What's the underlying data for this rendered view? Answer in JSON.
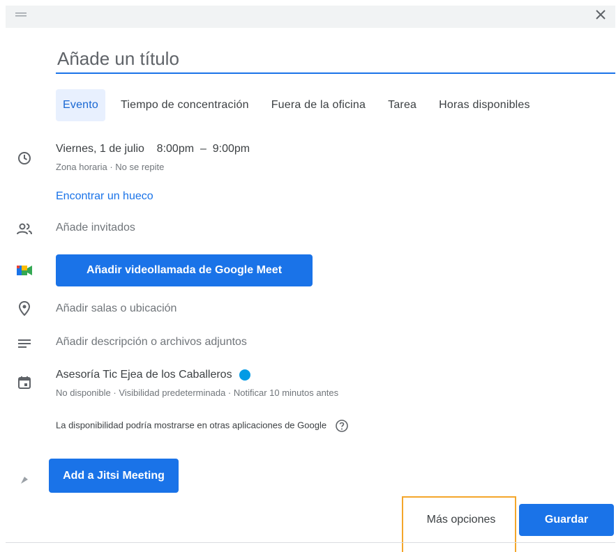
{
  "dialog": {
    "title_placeholder": "Añade un título"
  },
  "tabs": [
    {
      "label": "Evento",
      "active": true
    },
    {
      "label": "Tiempo de concentración",
      "active": false
    },
    {
      "label": "Fuera de la oficina",
      "active": false
    },
    {
      "label": "Tarea",
      "active": false
    },
    {
      "label": "Horas disponibles",
      "active": false
    }
  ],
  "datetime": {
    "main": "Viernes, 1 de julio    8:00pm  –  9:00pm",
    "sub": "Zona horaria · No se repite"
  },
  "find_slot_label": "Encontrar un hueco",
  "guests_label": "Añade invitados",
  "meet_button_label": "Añadir videollamada de Google Meet",
  "location_label": "Añadir salas o ubicación",
  "description_label": "Añadir descripción o archivos adjuntos",
  "calendar": {
    "name": "Asesoría Tic Ejea de los Caballeros",
    "color": "#039be5",
    "details": "No disponible · Visibilidad predeterminada · Notificar 10 minutos antes"
  },
  "availability_note": "La disponibilidad podría mostrarse en otras aplicaciones de Google",
  "jitsi_button_label": "Add a Jitsi Meeting",
  "footer": {
    "more_options_label": "Más opciones",
    "save_label": "Guardar"
  },
  "colors": {
    "accent": "#1a73e8",
    "highlight_box": "#f4a62a"
  }
}
